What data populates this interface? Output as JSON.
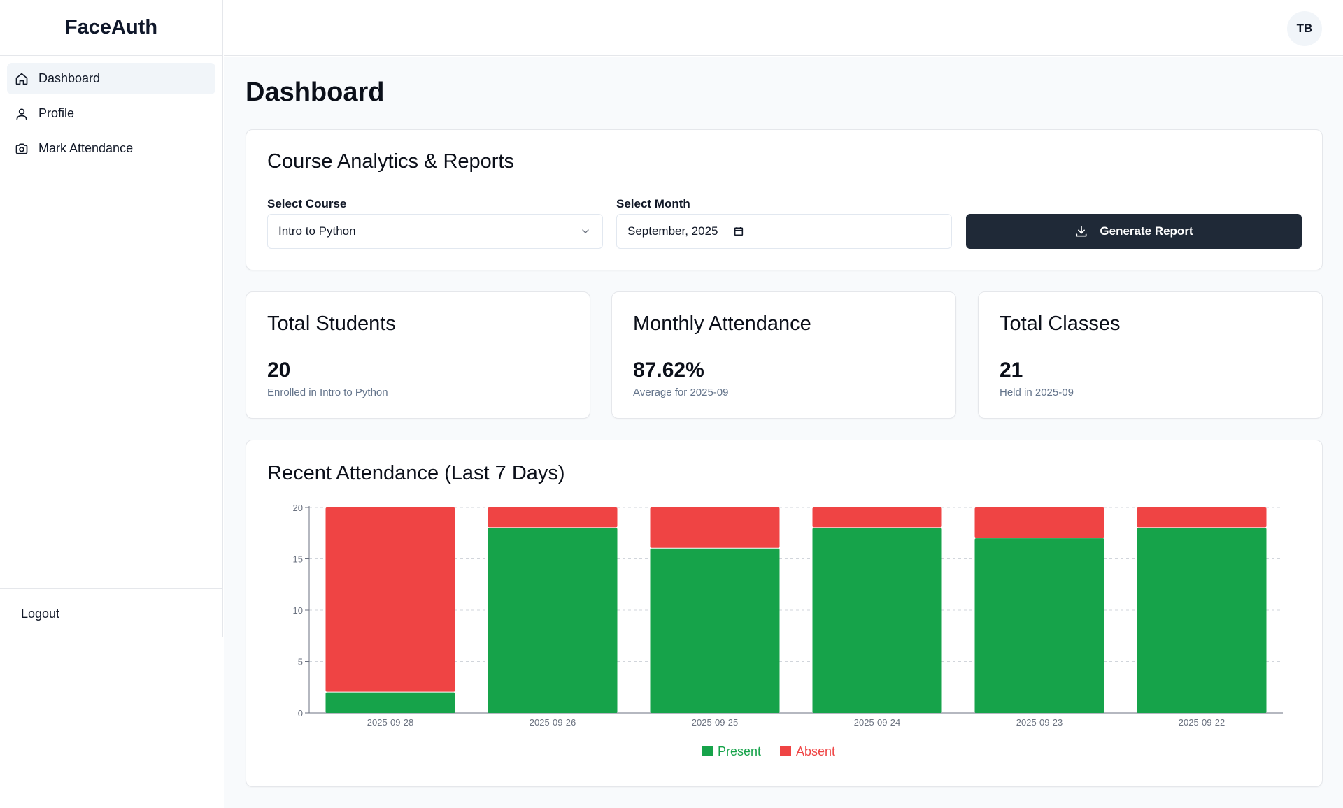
{
  "brand": "FaceAuth",
  "sidebar": {
    "items": [
      {
        "label": "Dashboard",
        "icon": "home-icon",
        "active": true
      },
      {
        "label": "Profile",
        "icon": "user-icon",
        "active": false
      },
      {
        "label": "Mark Attendance",
        "icon": "camera-icon",
        "active": false
      }
    ],
    "logout_label": "Logout"
  },
  "header": {
    "avatar_initials": "TB"
  },
  "page_title": "Dashboard",
  "filters": {
    "title": "Course Analytics & Reports",
    "course_label": "Select Course",
    "course_value": "Intro to Python",
    "month_label": "Select Month",
    "month_value": "September, 2025",
    "generate_label": "Generate Report"
  },
  "stats": [
    {
      "title": "Total Students",
      "value": "20",
      "sub": "Enrolled in Intro to Python"
    },
    {
      "title": "Monthly Attendance",
      "value": "87.62%",
      "sub": "Average for 2025-09"
    },
    {
      "title": "Total Classes",
      "value": "21",
      "sub": "Held in 2025-09"
    }
  ],
  "chart": {
    "title": "Recent Attendance (Last 7 Days)"
  },
  "colors": {
    "present": "#16a34a",
    "absent": "#ef4444",
    "button": "#1f2937"
  },
  "chart_data": {
    "type": "bar",
    "stacked": true,
    "title": "Recent Attendance (Last 7 Days)",
    "categories": [
      "2025-09-28",
      "2025-09-26",
      "2025-09-25",
      "2025-09-24",
      "2025-09-23",
      "2025-09-22"
    ],
    "series": [
      {
        "name": "Present",
        "values": [
          2,
          18,
          16,
          18,
          17,
          18
        ]
      },
      {
        "name": "Absent",
        "values": [
          18,
          2,
          4,
          2,
          3,
          2
        ]
      }
    ],
    "ylim": [
      0,
      20
    ],
    "yticks": [
      0,
      5,
      10,
      15,
      20
    ],
    "grid": true,
    "legend": "bottom-center"
  }
}
